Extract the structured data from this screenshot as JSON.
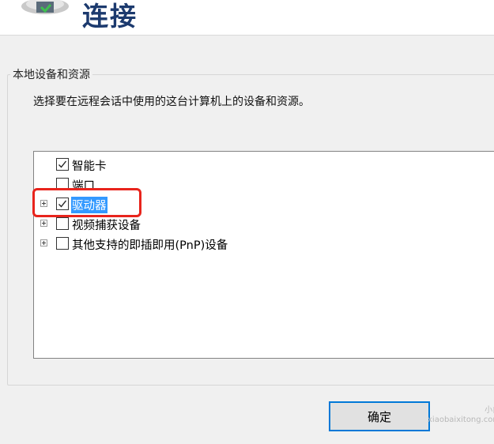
{
  "header": {
    "title": "连接",
    "icon": "remote-desktop-icon"
  },
  "group": {
    "label": "本地设备和资源",
    "description": "选择要在远程会话中使用的这台计算机上的设备和资源。"
  },
  "tree": {
    "items": [
      {
        "label": "智能卡",
        "checked": true,
        "expandable": false,
        "selected": false
      },
      {
        "label": "端口",
        "checked": false,
        "expandable": false,
        "selected": false
      },
      {
        "label": "驱动器",
        "checked": true,
        "expandable": true,
        "selected": true
      },
      {
        "label": "视频捕获设备",
        "checked": false,
        "expandable": true,
        "selected": false
      },
      {
        "label": "其他支持的即插即用(PnP)设备",
        "checked": false,
        "expandable": true,
        "selected": false
      }
    ]
  },
  "buttons": {
    "ok_label": "确定"
  },
  "watermark": {
    "line1": "小白",
    "line2": "xiaobaixitong.com"
  },
  "colors": {
    "title": "#1c3a6e",
    "selection": "#3399ff",
    "annotation": "#e8241c",
    "button_border": "#0078d7"
  }
}
